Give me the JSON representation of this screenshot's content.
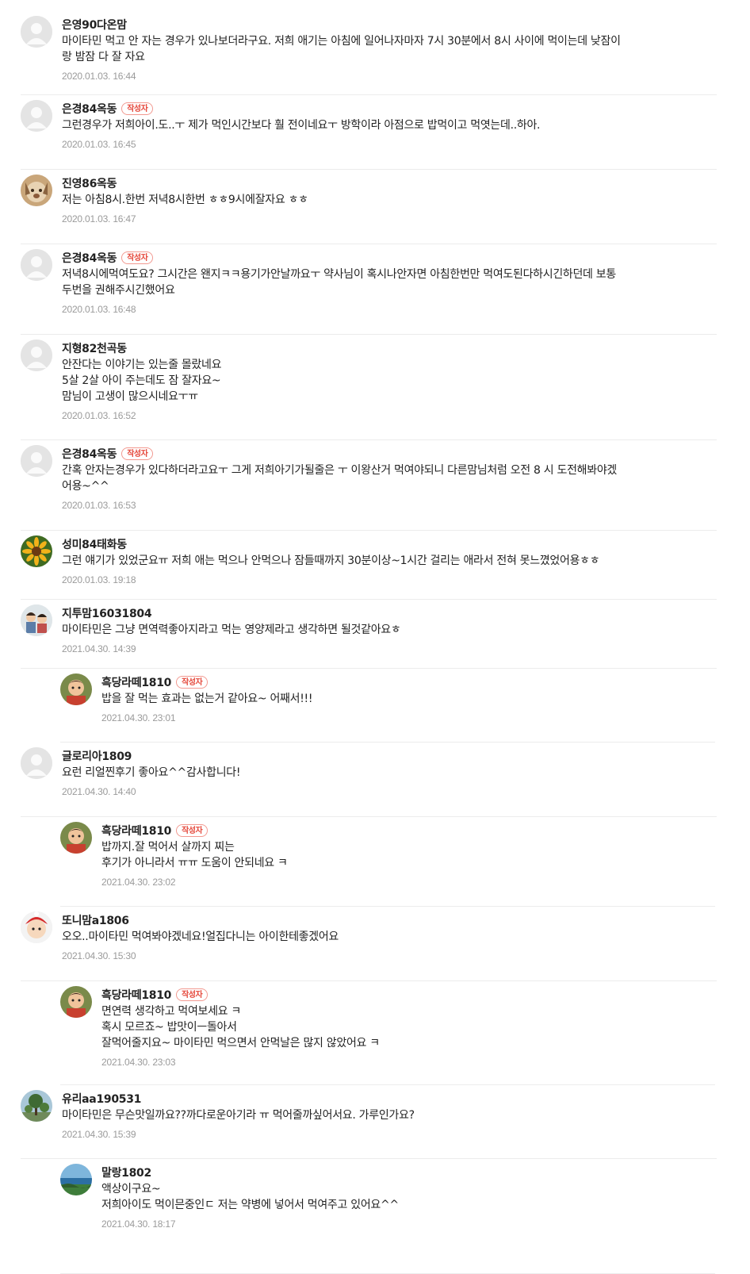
{
  "comments": [
    {
      "nickname": "은영90다온맘",
      "author": false,
      "text": "마이타민 먹고 안 자는 경우가 있나보더라구요. 저희 애기는 아침에 일어나자마자 7시 30분에서 8시 사이에 먹이는데 낮잠이\n랑 밤잠 다 잘 자요",
      "date": "2020.01.03. 16:44",
      "avatar": "default"
    },
    {
      "nickname": "은경84옥동",
      "author": true,
      "text": "그런경우가 저희아이.도..ㅜ 제가 먹인시간보다 훨 전이네요ㅜ 방학이라 아점으로 밥먹이고 먹엿는데..하아.",
      "date": "2020.01.03. 16:45",
      "avatar": "default"
    },
    {
      "nickname": "진영86옥동",
      "author": false,
      "text": "저는 아침8시.한번 저녁8시한번 ㅎㅎ9시에잘자요 ㅎㅎ",
      "date": "2020.01.03. 16:47",
      "avatar": "dog"
    },
    {
      "nickname": "은경84옥동",
      "author": true,
      "text": "저녁8시에먹여도요? 그시간은 왠지ㅋㅋ용기가안날까요ㅜ 약사님이 혹시나안자면 아침한번만 먹여도된다하시긴하던데 보통\n두번을 권해주시긴했어요",
      "date": "2020.01.03. 16:48",
      "avatar": "default"
    },
    {
      "nickname": "지형82천곡동",
      "author": false,
      "text": "안잔다는 이야기는 있는줄 몰랐네요\n5살 2살 아이 주는데도 잠 잘자요~\n맘님이 고생이 많으시네요ㅜㅠ",
      "date": "2020.01.03. 16:52",
      "avatar": "default"
    },
    {
      "nickname": "은경84옥동",
      "author": true,
      "text": "간혹 안자는경우가 있다하더라고요ㅜ 그게 저희아기가될줄은 ㅜ 이왕산거 먹여야되니 다른맘님처럼 오전 8 시 도전해봐야겠\n어용~^^",
      "date": "2020.01.03. 16:53",
      "avatar": "default"
    },
    {
      "nickname": "성미84태화동",
      "author": false,
      "text": "그런 얘기가 있었군요ㅠ 저희 애는 먹으나 안먹으나 잠들때까지 30분이상~1시간 걸리는 애라서 전혀 못느꼈었어용ㅎㅎ",
      "date": "2020.01.03. 19:18",
      "avatar": "flower"
    },
    {
      "nickname": "지투맘16031804",
      "author": false,
      "text": "마이타민은 그냥 면역력좋아지라고 먹는 영양제라고 생각하면 될것같아요ㅎ",
      "date": "2021.04.30. 14:39",
      "avatar": "kids"
    },
    {
      "nickname": "흑당라떼1810",
      "author": true,
      "reply": true,
      "text": "밥을 잘 먹는 효과는 없는거 같아요~ 어째서!!!",
      "date": "2021.04.30. 23:01",
      "avatar": "child"
    },
    {
      "nickname": "글로리아1809",
      "author": false,
      "text": "요런 리얼찐후기 좋아요^^감사합니다!",
      "date": "2021.04.30. 14:40",
      "avatar": "default"
    },
    {
      "nickname": "흑당라떼1810",
      "author": true,
      "reply": true,
      "text": "밥까지.잘 먹어서 살까지 찌는\n후기가 아니라서 ㅠㅠ 도움이 안되네요 ㅋ",
      "date": "2021.04.30. 23:02",
      "avatar": "child"
    },
    {
      "nickname": "또니맘a1806",
      "author": false,
      "text": "오오..마이타민 먹여봐야겠네요!얼집다니는 아이한테좋겠어요",
      "date": "2021.04.30. 15:30",
      "avatar": "baby"
    },
    {
      "nickname": "흑당라떼1810",
      "author": true,
      "reply": true,
      "text": "면연력 생각하고 먹여보세요 ㅋ\n혹시 모르죠~ 밥맛이ㅡ돌아서\n잘먹어줄지요~ 마이타민 먹으면서 안먹날은 많지 않았어요 ㅋ",
      "date": "2021.04.30. 23:03",
      "avatar": "child"
    },
    {
      "nickname": "유리aa190531",
      "author": false,
      "text": "마이타민은 무슨맛일까요??까다로운아기라 ㅠ 먹어줄까싶어서요. 가루인가요?",
      "date": "2021.04.30. 15:39",
      "avatar": "tree"
    },
    {
      "nickname": "말랑1802",
      "author": false,
      "reply": true,
      "text": "액상이구요~\n저희아이도 먹이믄중인ㄷ 저는 약병에 넣어서 먹여주고 있어요^^",
      "date": "2021.04.30. 18:17",
      "avatar": "sea"
    }
  ],
  "labels": {
    "author_badge": "작성자"
  }
}
